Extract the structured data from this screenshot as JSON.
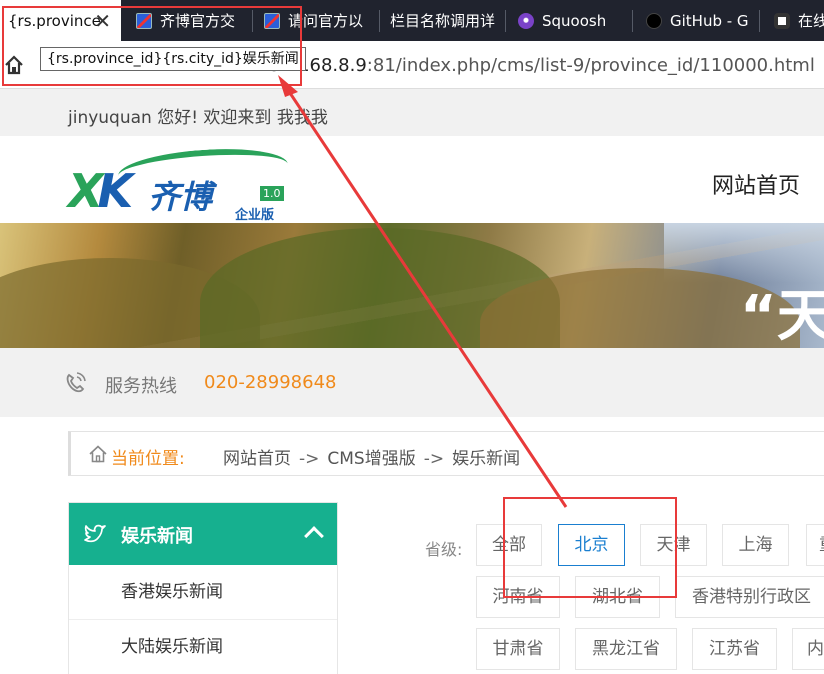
{
  "browser": {
    "tabs": [
      {
        "label": "{rs.province",
        "icon": "close-icon",
        "active": true
      },
      {
        "label": "齐博官方交",
        "icon": "qibo-favicon"
      },
      {
        "label": "请问官方以",
        "icon": "qibo-favicon"
      },
      {
        "label": "栏目名称调用详",
        "icon": ""
      },
      {
        "label": "Squoosh",
        "icon": "squoosh-favicon"
      },
      {
        "label": "GitHub - G",
        "icon": "github-favicon"
      },
      {
        "label": "在线",
        "icon": "zhixue-favicon"
      }
    ],
    "tab_close": "✕",
    "url_prefix": "192.168.8.9",
    "url_rest": ":81/index.php/cms/list-9/province_id/110000.html",
    "tooltip": "{rs.province_id}{rs.city_id}娱乐新闻"
  },
  "site": {
    "welcome": "jinyuquan 您好!  欢迎来到 我我我",
    "logo": {
      "brand": "齐博",
      "version": "1.0",
      "edition": "企业版"
    },
    "nav_home": "网站首页",
    "banner_slogan": "“天",
    "hotline_label": "服务热线",
    "hotline_number": "020-28998648",
    "breadcrumb": {
      "here": "当前位置:",
      "items": [
        "网站首页",
        "CMS增强版",
        "娱乐新闻"
      ],
      "sep": "->"
    },
    "sidebar": {
      "title": "娱乐新闻",
      "items": [
        "香港娱乐新闻",
        "大陆娱乐新闻"
      ]
    },
    "filter": {
      "label": "省级:",
      "row1": [
        "全部",
        "北京",
        "天津",
        "上海",
        "重"
      ],
      "row2": [
        "河南省",
        "湖北省",
        "香港特别行政区"
      ],
      "row3": [
        "甘肃省",
        "黑龙江省",
        "江苏省",
        "内"
      ],
      "selected": "北京"
    }
  },
  "colors": {
    "accent_green": "#16b08f",
    "orange": "#f08a1b",
    "annotation_red": "#e83a3a",
    "active_blue": "#1a7fd0"
  }
}
